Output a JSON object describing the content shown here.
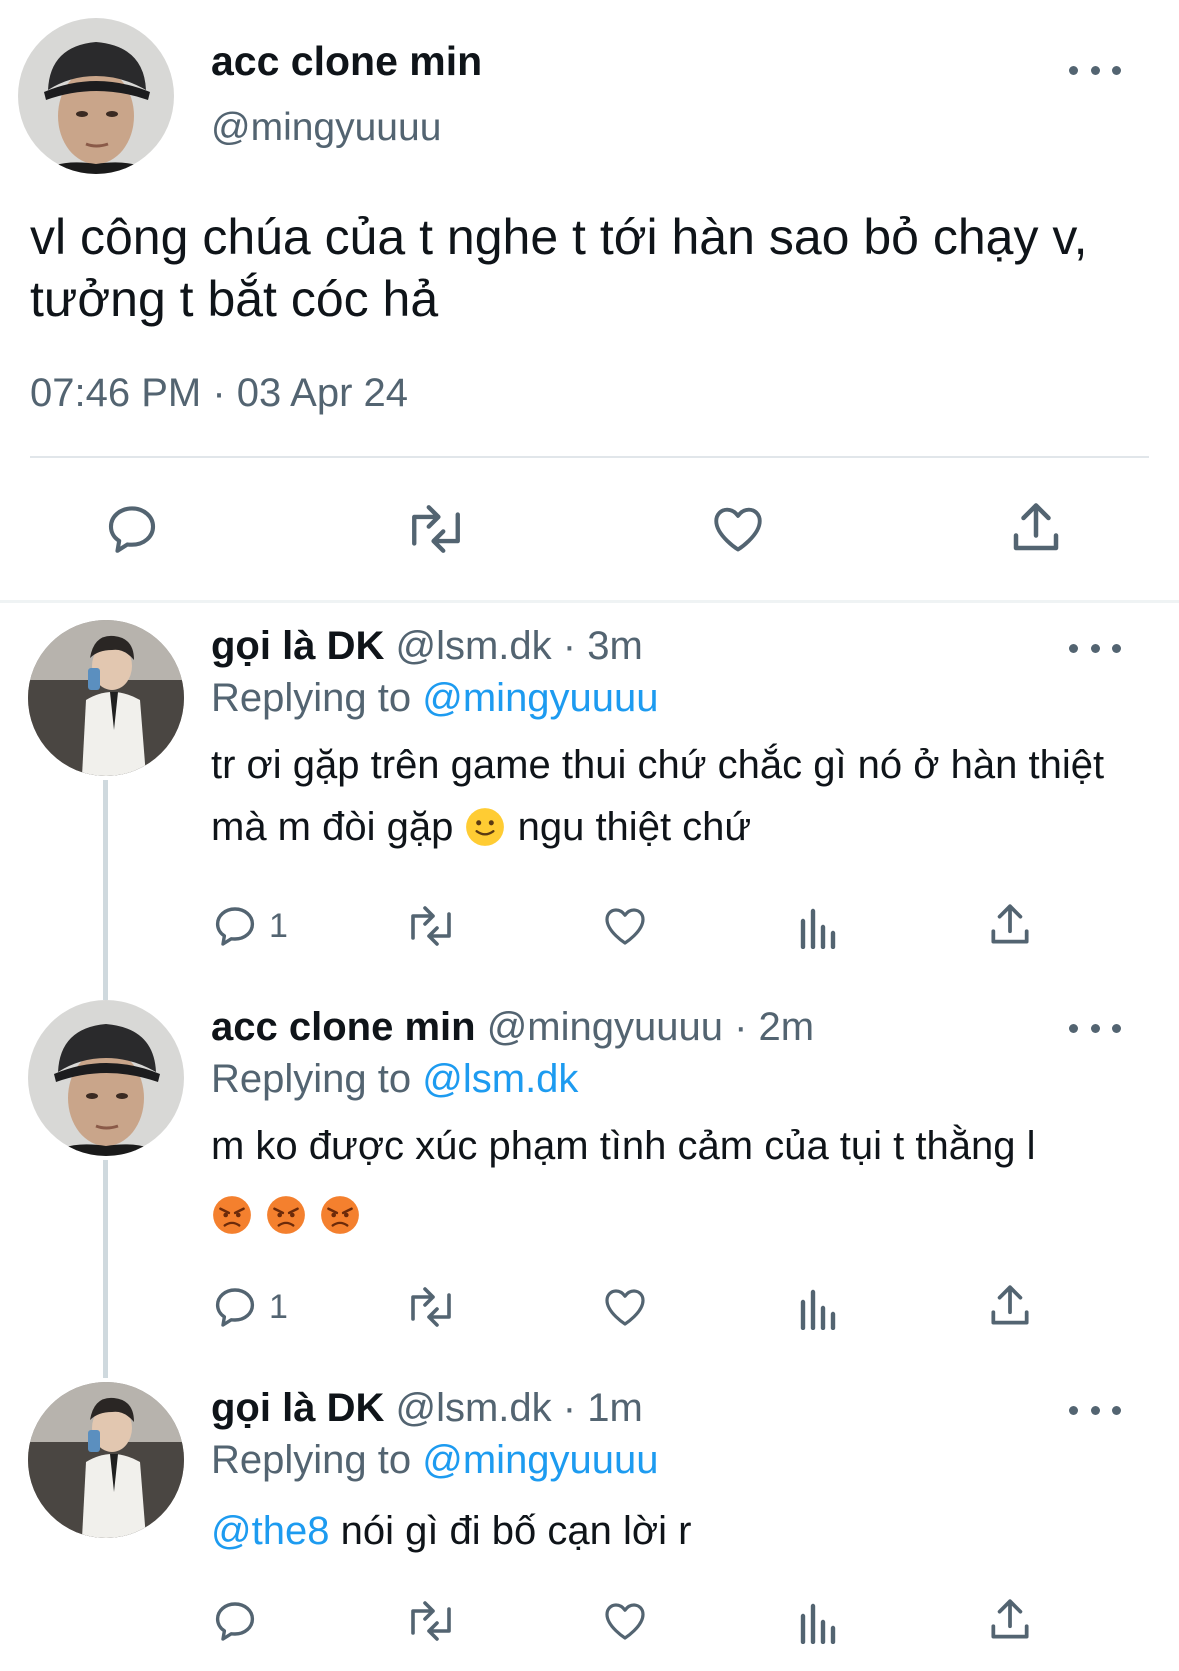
{
  "main_tweet": {
    "name": "acc clone min",
    "handle": "@mingyuuuu",
    "text": "vl công chúa của t nghe t tới hàn sao bỏ chạy v, tưởng t bắt cóc hả",
    "timestamp": "07:46 PM · 03 Apr 24"
  },
  "replies": [
    {
      "name": "gọi là DK",
      "handle": "@lsm.dk",
      "age": "· 3m",
      "replying_prefix": "Replying to",
      "replying_to": "@mingyuuuu",
      "text_before": "tr ơi gặp trên game thui chứ chắc gì nó ở hàn thiệt mà m đòi gặp",
      "text_after": " ngu thiệt chứ",
      "emoji": "slightly-smiling-face",
      "reply_count": "1"
    },
    {
      "name": "acc clone min",
      "handle": "@mingyuuuu",
      "age": "· 2m",
      "replying_prefix": "Replying to",
      "replying_to": "@lsm.dk",
      "text": "m ko được xúc phạm tình cảm của tụi t thằng l",
      "emoji": "angry-face",
      "reply_count": "1"
    },
    {
      "name": "gọi là DK",
      "handle": "@lsm.dk",
      "age": "· 1m",
      "replying_prefix": "Replying to",
      "replying_to": "@mingyuuuu",
      "mention": "@the8",
      "text": " nói gì đi bố cạn lời r"
    }
  ],
  "colors": {
    "text": "#0f1419",
    "secondary": "#536471",
    "link": "#1d9bf0",
    "divider": "#e1e6ea",
    "thread_line": "#cfd9de"
  }
}
